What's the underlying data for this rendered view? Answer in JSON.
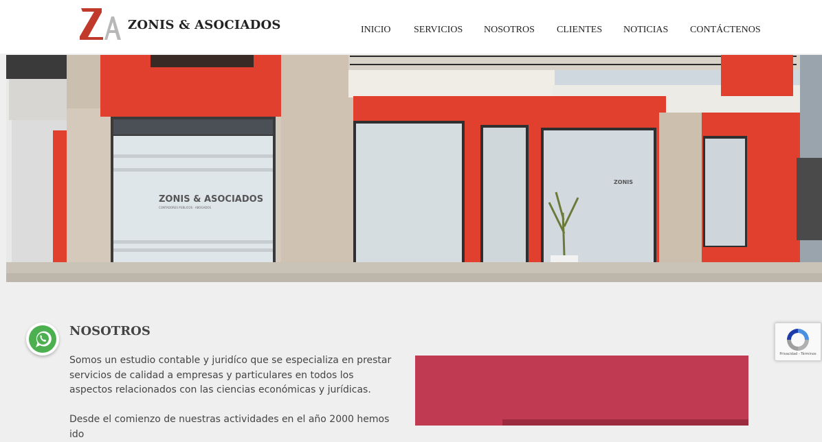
{
  "brand": {
    "logo_text": "ZA",
    "name": "ZONIS & ASOCIADOS"
  },
  "nav": {
    "items": [
      {
        "label": "INICIO"
      },
      {
        "label": "SERVICIOS"
      },
      {
        "label": "NOSOTROS"
      },
      {
        "label": "CLIENTES"
      },
      {
        "label": "NOTICIAS"
      },
      {
        "label": "CONTÁCTENOS"
      }
    ]
  },
  "hero": {
    "window_sign": "ZONIS & ASOCIADOS",
    "window_sign_sub": "CONTADORES PÚBLICOS · ABOGADOS"
  },
  "about": {
    "title": "NOSOTROS",
    "paragraph1": "Somos un estudio contable y juridíco que se especializa en prestar servicios de calidad a empresas y particulares en todos los aspectos relacionados con las ciencias económicas y jurídicas.",
    "paragraph2": "Desde el comienzo de nuestras actividades en el año 2000 hemos ido"
  },
  "widgets": {
    "whatsapp_icon": "whatsapp-icon",
    "recaptcha_text": "Privacidad - Términos"
  },
  "colors": {
    "brand_red": "#c0392b",
    "accent_block": "#c03a52",
    "facade_red": "#e2402f"
  }
}
